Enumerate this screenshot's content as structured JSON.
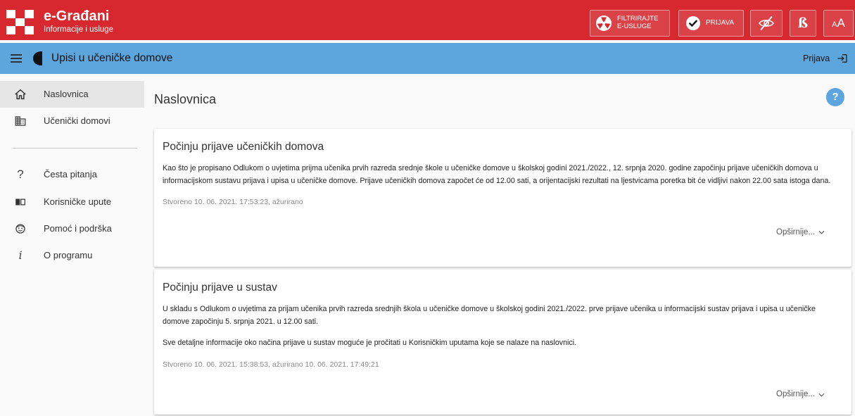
{
  "header": {
    "logo_title": "e-Građani",
    "logo_subtitle": "Informacije i usluge",
    "logo_icon": "checkerboard-logo",
    "filter_button": {
      "line1": "FILTRIRAJTE",
      "line2": "E-USLUGE",
      "icon": "filter-services-icon"
    },
    "login_button": {
      "label": "PRIJAVA",
      "icon": "check-circle-icon"
    },
    "contrast_button": {
      "icon": "eye-off-icon"
    },
    "dyslexia_font_button": {
      "icon": "dyslexia-font-icon"
    },
    "text_size_button": {
      "small": "A",
      "large": "A"
    },
    "colors": {
      "background": "#d7282f",
      "text": "#ffffff"
    }
  },
  "app_bar": {
    "title": "Upisi u učeničke domove",
    "login_label": "Prijava",
    "menu_icon": "menu-icon",
    "app_icon": "door-icon",
    "login_icon": "login-icon",
    "colors": {
      "background": "#5da6dd"
    }
  },
  "sidebar": {
    "items": [
      {
        "label": "Naslovnica",
        "icon": "home-icon",
        "active": true
      },
      {
        "label": "Učenički domovi",
        "icon": "building-icon",
        "active": false
      }
    ],
    "secondary_items": [
      {
        "label": "Česta pitanja",
        "icon": "question-icon"
      },
      {
        "label": "Korisničke upute",
        "icon": "book-icon"
      },
      {
        "label": "Pomoć i podrška",
        "icon": "support-icon"
      },
      {
        "label": "O programu",
        "icon": "info-icon"
      }
    ]
  },
  "main": {
    "title": "Naslovnica",
    "help_icon": "help-icon",
    "accent": "#5ca5de",
    "cards": [
      {
        "title": "Počinju prijave učeničkih domova",
        "paragraphs": [
          "Kao što je propisano Odlukom o uvjetima prijma učenika prvih razreda srednje škole u učeničke domove u školskoj godini 2021./2022., 12. srpnja 2020. godine započinju prijave učeničkih domova u informacijskom sustavu prijava i upisa u učeničke domove. Prijave učeničkih domova započet će od 12.00 sati, a orijentacijski rezultati na ljestvicama poretka bit će vidljivi nakon 22.00 sata istoga dana."
        ],
        "date": "Stvoreno 10. 06. 2021. 17:53:23, ažurirano",
        "more_label": "Opširnije..."
      },
      {
        "title": "Počinju prijave u sustav",
        "paragraphs": [
          "U skladu s Odlukom o uvjetima za prijam učenika prvih razreda srednjih škola u učeničke domove u školskoj godini 2021./2022. prve prijave učenika u informacijski sustav prijava i upisa u učeničke domove započinju 5. srpnja 2021. u 12.00 sati.",
          "Sve detaljne informacije oko načina prijave u sustav moguće je pročitati u Korisničkim uputama koje se nalaze na naslovnici."
        ],
        "date": "Stvoreno 10. 06. 2021. 15:38:53, ažurirano 10. 06. 2021. 17:49:21",
        "more_label": "Opširnije..."
      }
    ]
  }
}
